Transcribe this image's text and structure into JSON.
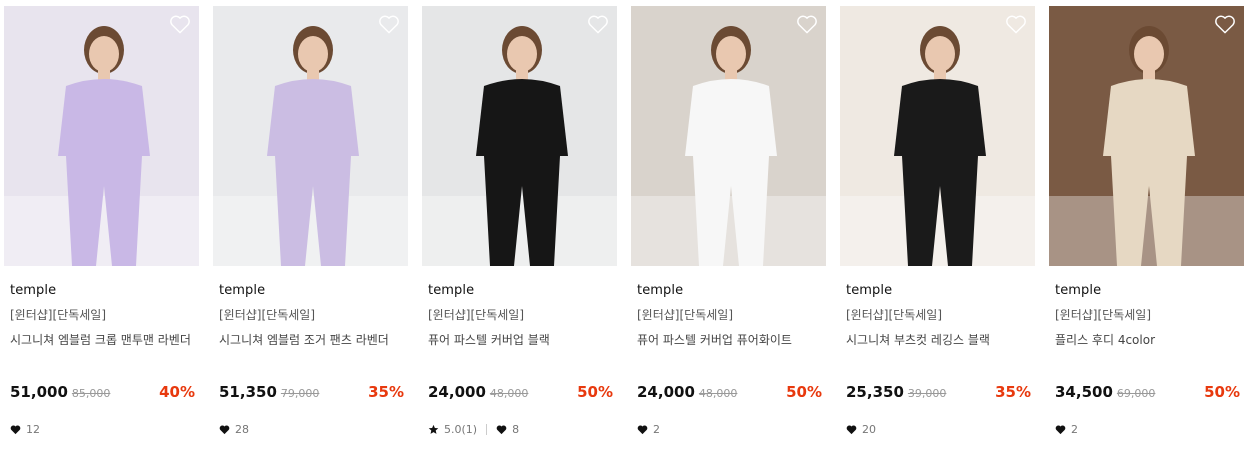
{
  "products": [
    {
      "brand": "temple",
      "tag": "[윈터샵][단독세일]",
      "name": "시그니쳐 엠블럼 크롭 맨투맨 라벤더",
      "price": "51,000",
      "original_price": "85,000",
      "discount": "40%",
      "rating": "",
      "likes": "12",
      "image_icon": "lavender-sweatshirt-photo",
      "bg": "#e8e4ee",
      "outfit": "#c9b8e6"
    },
    {
      "brand": "temple",
      "tag": "[윈터샵][단독세일]",
      "name": "시그니쳐 엠블럼 조거 팬츠 라벤더",
      "price": "51,350",
      "original_price": "79,000",
      "discount": "35%",
      "rating": "",
      "likes": "28",
      "image_icon": "lavender-jogger-photo",
      "bg": "#e9eaec",
      "outfit": "#cbbde3"
    },
    {
      "brand": "temple",
      "tag": "[윈터샵][단독세일]",
      "name": "퓨어 파스텔 커버업 블랙",
      "price": "24,000",
      "original_price": "48,000",
      "discount": "50%",
      "rating": "5.0(1)",
      "likes": "8",
      "image_icon": "black-coverup-photo",
      "bg": "#e5e6e7",
      "outfit": "#161616"
    },
    {
      "brand": "temple",
      "tag": "[윈터샵][단독세일]",
      "name": "퓨어 파스텔 커버업 퓨어화이트",
      "price": "24,000",
      "original_price": "48,000",
      "discount": "50%",
      "rating": "",
      "likes": "2",
      "image_icon": "white-coverup-photo",
      "bg": "#d9d3cc",
      "outfit": "#f7f7f7"
    },
    {
      "brand": "temple",
      "tag": "[윈터샵][단독세일]",
      "name": "시그니쳐 부츠컷 레깅스 블랙",
      "price": "25,350",
      "original_price": "39,000",
      "discount": "35%",
      "rating": "",
      "likes": "20",
      "image_icon": "black-bootcut-leggings-photo",
      "bg": "#efe9e2",
      "outfit": "#1a1a1a"
    },
    {
      "brand": "temple",
      "tag": "[윈터샵][단독세일]",
      "name": "플리스 후디 4color",
      "price": "34,500",
      "original_price": "69,000",
      "discount": "50%",
      "rating": "",
      "likes": "2",
      "image_icon": "beige-fleece-hoodie-photo",
      "bg": "#7a5a44",
      "outfit": "#e6d8c3"
    }
  ],
  "colors": {
    "discount": "#e8390e",
    "brand_text": "#111111",
    "muted": "#999999"
  },
  "icons": {
    "wishlist": "heart-outline-icon",
    "likes": "heart-filled-icon",
    "rating": "star-filled-icon"
  }
}
